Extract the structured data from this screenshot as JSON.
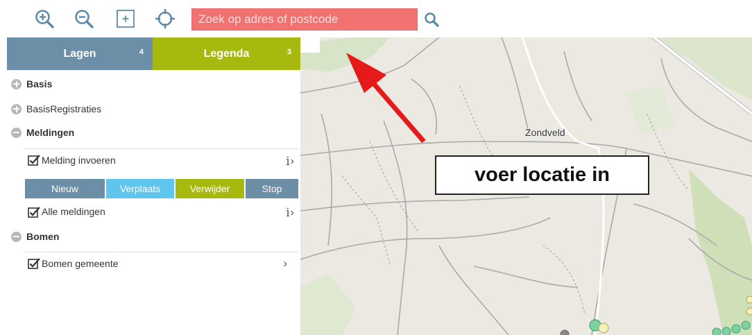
{
  "toolbar": {
    "zoom_in_icon": "zoom-in-icon",
    "zoom_out_icon": "zoom-out-icon",
    "extent_icon": "plus-box-icon",
    "locate_icon": "crosshair-icon",
    "search_placeholder": "Zoek op adres of postcode",
    "search_value": "",
    "search_icon": "search-icon",
    "accent_search": "#f27272"
  },
  "tabs": [
    {
      "label": "Lagen",
      "count": "4",
      "color": "#6c8ea6"
    },
    {
      "label": "Legenda",
      "count": "3",
      "color": "#a7b90e"
    }
  ],
  "tree": {
    "groups": [
      {
        "label": "Basis",
        "state": "collapsed"
      },
      {
        "label": "BasisRegistraties",
        "state": "collapsed"
      },
      {
        "label": "Meldingen",
        "state": "expanded"
      },
      {
        "label": "Bomen",
        "state": "expanded"
      }
    ],
    "layers": [
      {
        "label": "Melding invoeren",
        "checked": true,
        "info": "i"
      },
      {
        "label": "Alle meldingen",
        "checked": true,
        "info": "i"
      },
      {
        "label": "Bomen gemeente",
        "checked": true,
        "info": ""
      }
    ],
    "actions": [
      "Nieuw",
      "Verplaats",
      "Verwijder",
      "Stop"
    ]
  },
  "map": {
    "place_label": "Zondveld",
    "callout": "voer locatie in",
    "arrow_color": "#e51b1b"
  }
}
